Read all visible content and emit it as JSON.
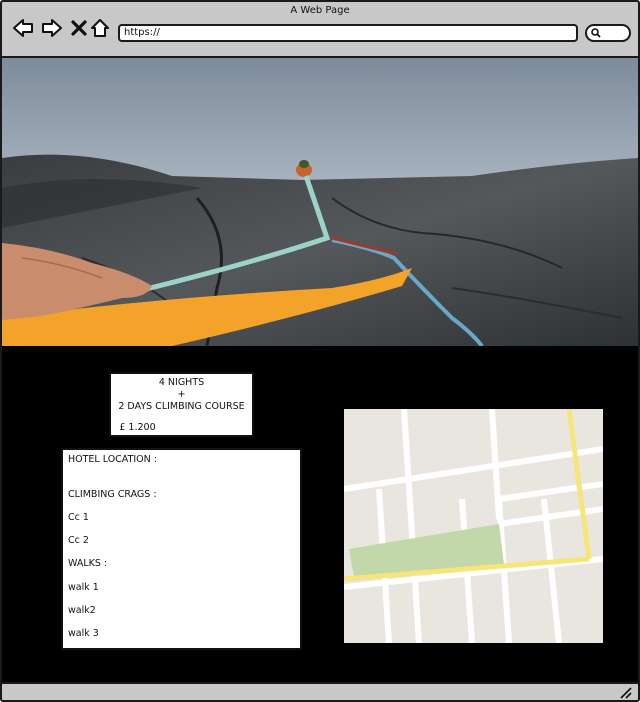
{
  "window": {
    "title": "A Web Page",
    "url": "https://"
  },
  "nav_icons": [
    "back-arrow-icon",
    "forward-arrow-icon",
    "close-icon",
    "home-icon",
    "search-icon",
    "resize-grip-icon"
  ],
  "hero": {
    "image": "rock-climbing-photo"
  },
  "package": {
    "line1": "4 NIGHTS",
    "line2": "+",
    "line3": "2 DAYS CLIMBING COURSE",
    "price": "£ 1.200"
  },
  "info": {
    "hotel_location": "HOTEL LOCATION :",
    "climbing_crags": "CLIMBING CRAGS :",
    "crags": [
      "Cc 1",
      "Cc 2"
    ],
    "walks_heading": "WALKS :",
    "walks": [
      "walk 1",
      "walk2",
      "walk 3"
    ]
  },
  "map": {
    "image": "map",
    "colors": {
      "background": "#e9e6e0",
      "road": "#ffffff",
      "highway": "#f5e57a",
      "park": "#c2d8a8"
    }
  }
}
